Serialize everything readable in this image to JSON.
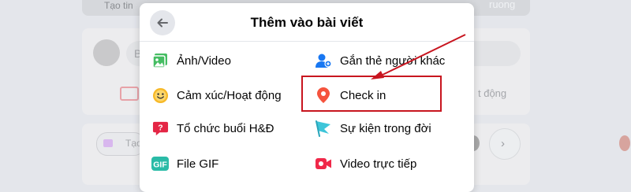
{
  "background": {
    "story_left_label": "Tạo tin",
    "story_right_label": "ruong",
    "composer_letter": "B",
    "right_text": "t động",
    "room_label": "Tạo",
    "chevron": "›"
  },
  "modal": {
    "title": "Thêm vào bài viết",
    "back_icon": "arrow-left-icon",
    "options_left": [
      {
        "label": "Ảnh/Video",
        "icon": "photo-icon"
      },
      {
        "label": "Cảm xúc/Hoạt động",
        "icon": "smiley-icon"
      },
      {
        "label": "Tổ chức buổi H&Đ",
        "icon": "qa-icon"
      },
      {
        "label": "File GIF",
        "icon": "gif-icon"
      }
    ],
    "options_right": [
      {
        "label": "Gắn thẻ người khác",
        "icon": "tag-people-icon"
      },
      {
        "label": "Check in",
        "icon": "location-pin-icon"
      },
      {
        "label": "Sự kiện trong đời",
        "icon": "flag-icon"
      },
      {
        "label": "Video trực tiếp",
        "icon": "live-video-icon"
      }
    ],
    "gif_icon_text": "GIF"
  },
  "colors": {
    "photo": "#45bd62",
    "smiley": "#f7b928",
    "qa": "#e42645",
    "gif": "#2abba7",
    "tag": "#1877f2",
    "pin": "#f5533d",
    "flag": "#3ec5d9",
    "live": "#f02849",
    "annotation": "#c8151f"
  }
}
